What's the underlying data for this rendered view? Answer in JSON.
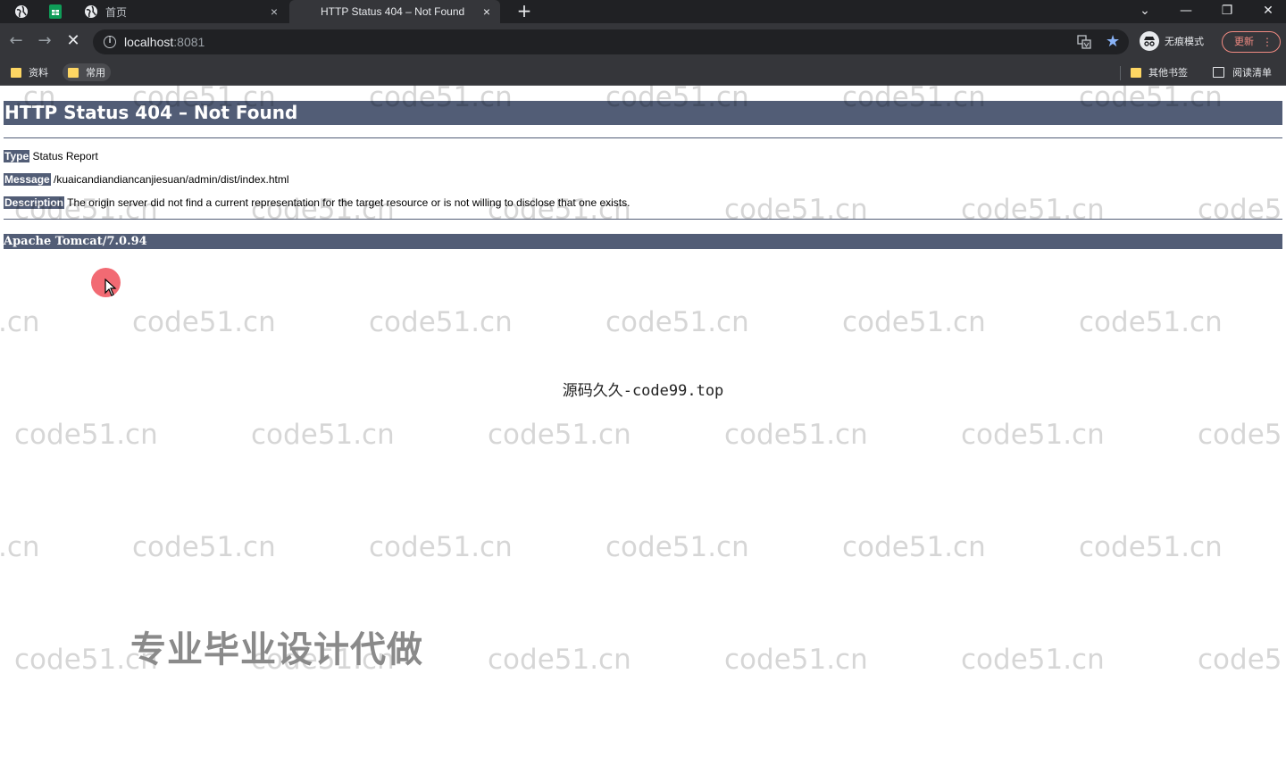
{
  "browser": {
    "tabs": [
      {
        "title": "首页",
        "active": false
      },
      {
        "title": "HTTP Status 404 – Not Found",
        "active": true
      }
    ],
    "tab_close": "×",
    "new_tab": "+",
    "address": {
      "host": "localhost",
      "port": ":8081"
    },
    "incognito_label": "无痕模式",
    "update_label": "更新",
    "bookmarks": {
      "left": [
        {
          "label": "资料"
        },
        {
          "label": "常用"
        }
      ],
      "other": "其他书签",
      "reading_list": "阅读清单"
    },
    "colors": {
      "chrome_dark": "#202124",
      "chrome_mid": "#35363a",
      "accent_blue": "#8ab4f8",
      "update_red": "#f28b82"
    }
  },
  "page": {
    "heading": "HTTP Status 404 – Not Found",
    "rows": [
      {
        "label": "Type",
        "value": "Status Report"
      },
      {
        "label": "Message",
        "value": "/kuaicandiandiancanjiesuan/admin/dist/index.html"
      },
      {
        "label": "Description",
        "value": "The origin server did not find a current representation for the target resource or is not willing to disclose that one exists."
      }
    ],
    "server": "Apache Tomcat/7.0.94",
    "header_color": "#525d76"
  },
  "overlay": {
    "watermark": "code51.cn",
    "watermark_edge_left": ".cn",
    "watermark_edge_right": "code5",
    "center_text": "源码久久-code99.top",
    "promo": "专业毕业设计代做"
  }
}
